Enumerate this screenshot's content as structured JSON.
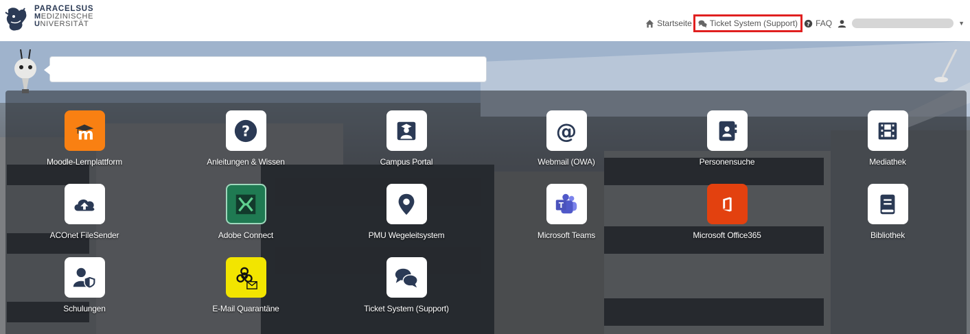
{
  "header": {
    "logo_line1": "PARACELSUS",
    "logo_line2_initial": "M",
    "logo_line2_rest": "EDIZINISCHE",
    "logo_line3_initial": "U",
    "logo_line3_rest": "NIVERSITÄT"
  },
  "nav": {
    "home": "Startseite",
    "ticket": "Ticket System (Support)",
    "faq": "FAQ"
  },
  "search": {
    "value": "",
    "placeholder": ""
  },
  "tiles": [
    {
      "label": "Moodle-Lernplattform",
      "icon": "moodle-icon",
      "color": "#f98012"
    },
    {
      "label": "Anleitungen & Wissen",
      "icon": "question-circle-icon",
      "color": "#ffffff"
    },
    {
      "label": "Campus Portal",
      "icon": "graduate-user-icon",
      "color": "#ffffff"
    },
    {
      "label": "Webmail (OWA)",
      "icon": "at-sign-icon",
      "color": "#ffffff"
    },
    {
      "label": "Personensuche",
      "icon": "address-book-icon",
      "color": "#ffffff"
    },
    {
      "label": "Mediathek",
      "icon": "film-icon",
      "color": "#ffffff"
    },
    {
      "label": "ACOnet FileSender",
      "icon": "cloud-upload-icon",
      "color": "#ffffff"
    },
    {
      "label": "Adobe Connect",
      "icon": "adobe-connect-icon",
      "color": "#1f7a52"
    },
    {
      "label": "PMU Wegeleitsystem",
      "icon": "map-marker-icon",
      "color": "#ffffff"
    },
    {
      "label": "Microsoft Teams",
      "icon": "teams-icon",
      "color": "#ffffff"
    },
    {
      "label": "Microsoft Office365",
      "icon": "office-icon",
      "color": "#e3410f"
    },
    {
      "label": "Bibliothek",
      "icon": "book-icon",
      "color": "#ffffff"
    },
    {
      "label": "Schulungen",
      "icon": "user-shield-icon",
      "color": "#ffffff"
    },
    {
      "label": "E-Mail Quarantäne",
      "icon": "biohazard-mail-icon",
      "color": "#f2e500"
    },
    {
      "label": "Ticket System (Support)",
      "icon": "comments-icon",
      "color": "#ffffff"
    }
  ],
  "colors": {
    "icon_dark": "#2b3a55",
    "highlight": "#e02020"
  }
}
